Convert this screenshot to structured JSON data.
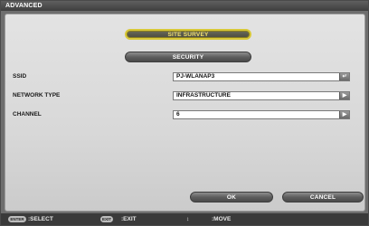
{
  "window": {
    "title": "ADVANCED"
  },
  "buttons": {
    "site_survey": "SITE SURVEY",
    "security": "SECURITY",
    "ok": "OK",
    "cancel": "CANCEL"
  },
  "fields": [
    {
      "label": "SSID",
      "value": "PJ-WLANAP3",
      "button_icon": "enter-icon",
      "button_glyph": "↵"
    },
    {
      "label": "NETWORK TYPE",
      "value": "INFRASTRUCTURE",
      "button_icon": "play-icon",
      "button_glyph": "▶"
    },
    {
      "label": "CHANNEL",
      "value": "6",
      "button_icon": "play-icon",
      "button_glyph": "▶"
    }
  ],
  "status": {
    "select_key": "ENTER",
    "select_label": ":SELECT",
    "exit_key": "EXIT",
    "exit_label": ":EXIT",
    "move_icon": "↕",
    "move_label": ":MOVE"
  },
  "colors": {
    "highlight_border": "#d8c838",
    "highlight_text": "#f0e070",
    "panel_bg": "#dcdcdc",
    "titlebar_bg": "#4a4a4a"
  }
}
